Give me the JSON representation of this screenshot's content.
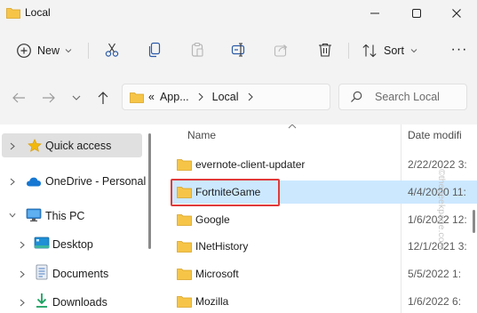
{
  "window": {
    "title": "Local",
    "minimize_icon": "minimize-icon",
    "maximize_icon": "maximize-icon",
    "close_icon": "close-icon"
  },
  "toolbar": {
    "new_label": "New",
    "sort_label": "Sort",
    "more_label": "···",
    "icons": [
      "cut-icon",
      "copy-icon",
      "paste-icon",
      "rename-icon",
      "share-icon",
      "delete-icon"
    ]
  },
  "address": {
    "overflow": "«",
    "crumbs": [
      "App...",
      "Local"
    ],
    "search_placeholder": "Search Local"
  },
  "nav": {
    "items": [
      {
        "label": "Quick access",
        "icon": "star-icon"
      },
      {
        "label": "OneDrive - Personal",
        "icon": "cloud-icon"
      },
      {
        "label": "This PC",
        "icon": "monitor-icon"
      },
      {
        "label": "Desktop",
        "icon": "desktop-icon"
      },
      {
        "label": "Documents",
        "icon": "documents-icon"
      },
      {
        "label": "Downloads",
        "icon": "download-icon"
      }
    ]
  },
  "files": {
    "header_name": "Name",
    "header_date": "Date modifi",
    "rows": [
      {
        "name": "evernote-client-updater",
        "date": "2/22/2022 3:"
      },
      {
        "name": "FortniteGame",
        "date": "4/4/2020 11:"
      },
      {
        "name": "Google",
        "date": "1/6/2022 12:"
      },
      {
        "name": "INetHistory",
        "date": "12/1/2021 3:"
      },
      {
        "name": "Microsoft",
        "date": "5/5/2022 1:"
      },
      {
        "name": "Mozilla",
        "date": "1/6/2022 6:"
      }
    ]
  },
  "watermark": "©thegeekpage.com",
  "colors": {
    "folder": "#f6c548",
    "selection": "#cce8ff",
    "highlight_border": "#e03a3a",
    "star": "#f2b80c",
    "onedrive": "#1677d2"
  }
}
